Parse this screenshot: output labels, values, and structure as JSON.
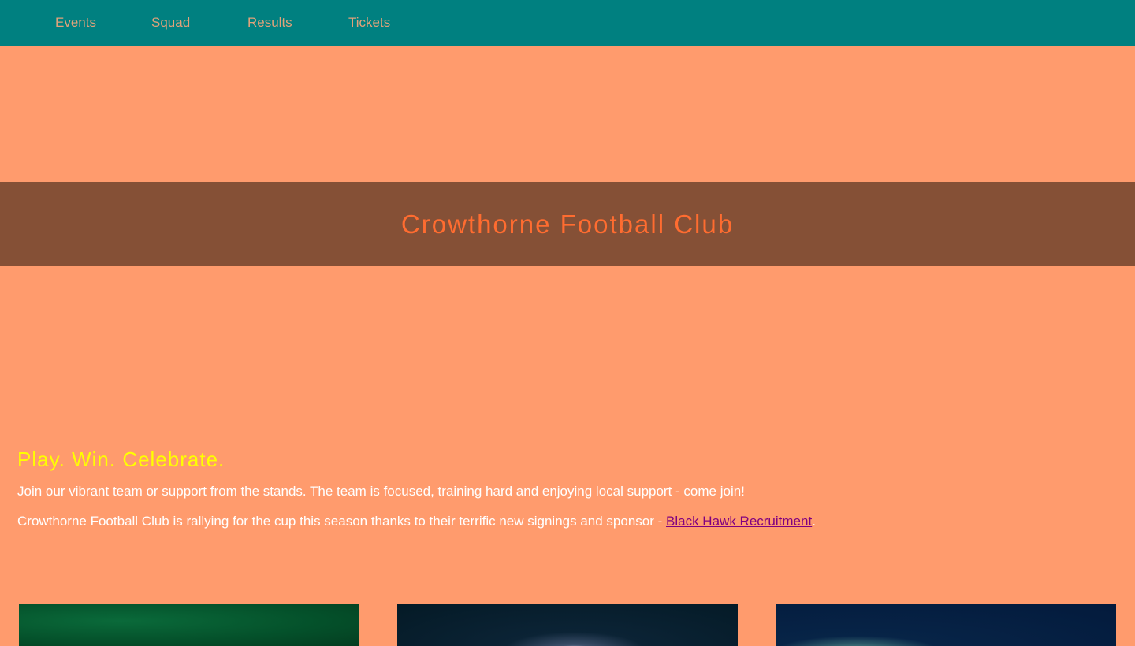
{
  "nav": {
    "items": [
      {
        "label": "Events"
      },
      {
        "label": "Squad"
      },
      {
        "label": "Results"
      },
      {
        "label": "Tickets"
      }
    ]
  },
  "hero": {
    "title": "Crowthorne Football Club"
  },
  "main": {
    "tagline": "Play. Win. Celebrate.",
    "paragraph_1": "Join our vibrant team or support from the stands. The team is focused, training hard and enjoying local support - come join!",
    "paragraph_2_prefix": "Crowthorne Football Club is rallying for the cup this season thanks to their terrific new signings and sponsor - ",
    "sponsor_link": "Black Hawk Recruitment",
    "paragraph_2_suffix": "."
  },
  "colors": {
    "nav_bg": "#008080",
    "nav_text": "#e2a27a",
    "page_bg": "#ff9b6d",
    "hero_band": "#855036",
    "hero_title": "#ff6c30",
    "tagline": "#ffff00",
    "body_text": "#ffffff",
    "link": "#800080"
  }
}
